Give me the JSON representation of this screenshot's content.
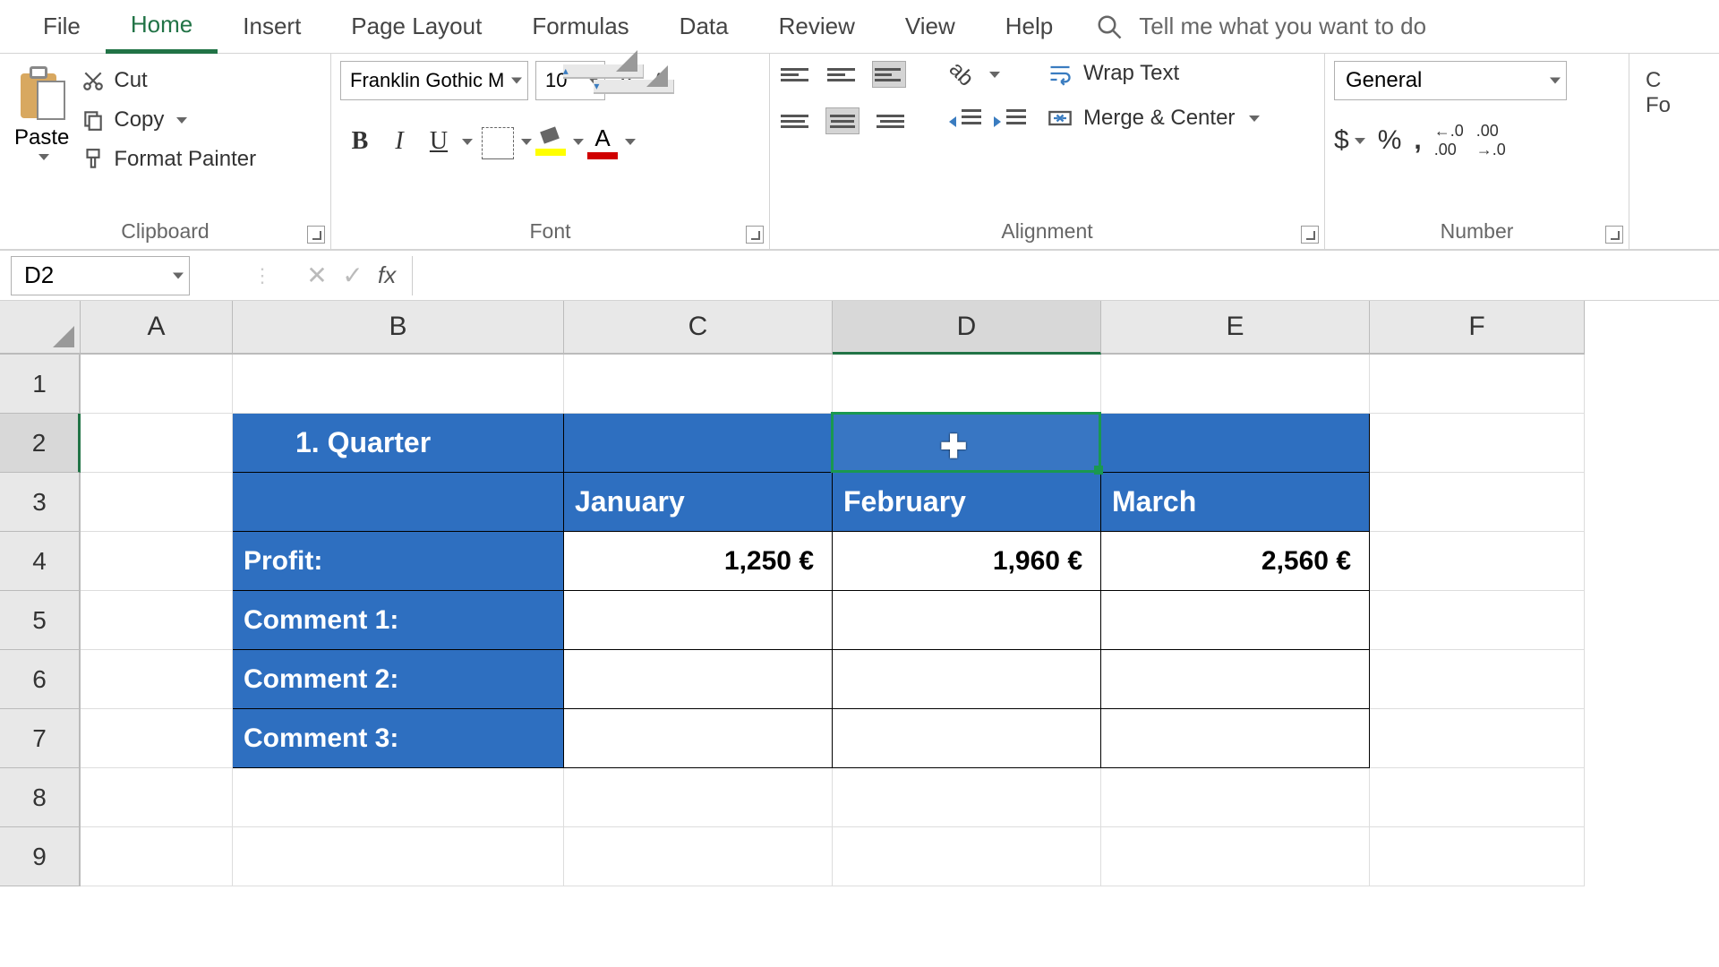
{
  "menu": {
    "tabs": [
      "File",
      "Home",
      "Insert",
      "Page Layout",
      "Formulas",
      "Data",
      "Review",
      "View",
      "Help"
    ],
    "active": "Home",
    "search_placeholder": "Tell me what you want to do"
  },
  "ribbon": {
    "clipboard": {
      "label": "Clipboard",
      "paste": "Paste",
      "cut": "Cut",
      "copy": "Copy",
      "format_painter": "Format Painter"
    },
    "font": {
      "label": "Font",
      "name": "Franklin Gothic M",
      "size": "10"
    },
    "alignment": {
      "label": "Alignment",
      "wrap": "Wrap Text",
      "merge": "Merge & Center"
    },
    "number": {
      "label": "Number",
      "format": "General"
    }
  },
  "formula_bar": {
    "name_box": "D2",
    "fx": "fx",
    "formula": ""
  },
  "grid": {
    "cols": [
      "A",
      "B",
      "C",
      "D",
      "E",
      "F"
    ],
    "rows": [
      "1",
      "2",
      "3",
      "4",
      "5",
      "6",
      "7",
      "8",
      "9"
    ],
    "selected_col": "D",
    "selected_row": "2"
  },
  "table": {
    "title": "1. Quarter",
    "months": [
      "January",
      "February",
      "March"
    ],
    "profit_label": "Profit:",
    "profit": [
      "1,250 €",
      "1,960 €",
      "2,560 €"
    ],
    "comments": [
      "Comment 1:",
      "Comment 2:",
      "Comment 3:"
    ]
  }
}
